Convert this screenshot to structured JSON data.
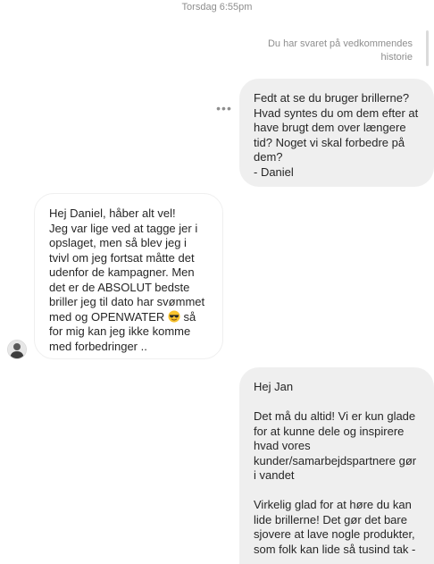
{
  "thread": {
    "timestamp": "Torsdag 6:55pm",
    "reply_note": "Du har svaret på vedkommendes historie"
  },
  "messages": [
    {
      "direction": "outgoing",
      "text": "Fedt at se du bruger brillerne? Hvad syntes du om dem efter at have brugt dem over længere tid? Noget vi skal forbedre på dem?\n- Daniel"
    },
    {
      "direction": "incoming",
      "text_before_emoji": "Hej Daniel, håber alt vel!\nJeg var lige ved at tagge jer i opslaget, men så blev jeg i tvivl om jeg fortsat måtte det udenfor de kampagner. Men det er de ABSOLUT bedste briller jeg til dato har svømmet med og OPENWATER ",
      "emoji_icon": "sunglasses-emoji",
      "text_after_emoji": " så for mig kan jeg ikke komme med forbedringer .."
    },
    {
      "direction": "outgoing",
      "text": "Hej Jan\n\nDet må du altid! Vi er kun glade for at kunne dele og inspirere hvad vores kunder/samarbejdspartnere gør i vandet\n\nVirkelig glad for at høre du kan lide brillerne! Det gør det bare sjovere at lave nogle produkter, som folk kan lide så tusind tak -"
    }
  ],
  "icons": {
    "more_options": "more-horizontal-icon",
    "avatar": "user-avatar"
  },
  "colors": {
    "outgoing_bubble": "#efefef",
    "incoming_border": "#efefef",
    "meta_text": "#8e8e8e"
  }
}
